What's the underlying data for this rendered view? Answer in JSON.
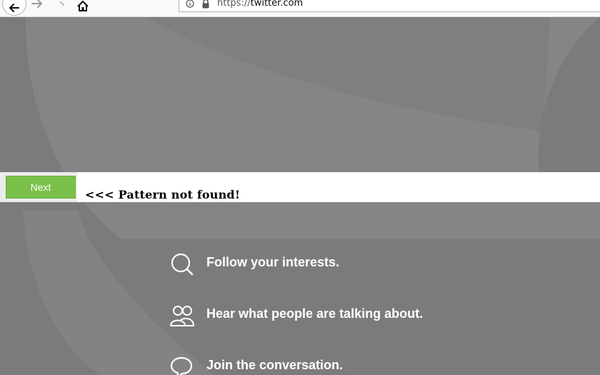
{
  "browser": {
    "url_scheme": "https://",
    "url_host": "twitter.com"
  },
  "findbar": {
    "next_label": "Next",
    "status": "<<< Pattern not found!"
  },
  "features": [
    {
      "icon": "search-icon",
      "text": "Follow your interests."
    },
    {
      "icon": "people-icon",
      "text": "Hear what people are talking about."
    },
    {
      "icon": "speech-bubble-icon",
      "text": "Join the conversation."
    }
  ],
  "colors": {
    "page_background": "#7b7b7b",
    "bird_silhouette": "#868686",
    "next_button": "#7ac04a",
    "feature_text": "#ffffff"
  }
}
